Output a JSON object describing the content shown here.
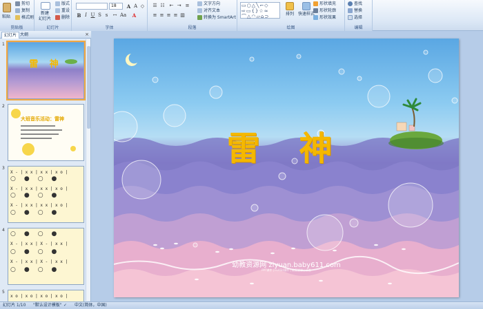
{
  "ribbon": {
    "groups": [
      {
        "name": "clipboard",
        "title": "剪贴板"
      },
      {
        "name": "slides",
        "title": "幻灯片"
      },
      {
        "name": "font",
        "title": "字体"
      },
      {
        "name": "paragraph",
        "title": "段落"
      },
      {
        "name": "drawing",
        "title": "绘图"
      },
      {
        "name": "editing",
        "title": "编辑"
      }
    ],
    "clipboard": {
      "paste": "粘贴",
      "cut": "剪切",
      "copy": "复制",
      "format_painter": "格式刷"
    },
    "slides": {
      "new_slide_line1": "新建",
      "new_slide_line2": "幻灯片",
      "layout": "版式",
      "reset": "重设",
      "delete": "删除"
    },
    "font": {
      "font_name": "",
      "font_size": "18"
    },
    "paragraph": {
      "text_direction": "文字方向",
      "align_text": "对齐文本",
      "smartart": "转换为 SmartArt"
    },
    "drawing": {
      "arrange": "排列",
      "quick_styles": "快速样式",
      "shape_fill": "形状填充",
      "shape_outline": "形状轮廓",
      "shape_effects": "形状效果"
    },
    "editing": {
      "find": "查找",
      "replace": "替换",
      "select": "选择"
    }
  },
  "panel": {
    "tab_slides": "幻灯片",
    "tab_outline": "大纲",
    "close": "×",
    "thumbs": [
      {
        "num": "1",
        "title": "雷 神"
      },
      {
        "num": "2",
        "title": "大班音乐活动：雷神"
      },
      {
        "num": "3",
        "rows": [
          "X - | x x | x x | x o |",
          "X - | x x | x x | x o |",
          "X - | x x | x x | x o |"
        ]
      },
      {
        "num": "4",
        "rows": [
          "X - | x x | X - | x x |",
          "X - | x x | X - | x x |"
        ]
      },
      {
        "num": "5",
        "rows": [
          "x o | x o | x o | x o |"
        ]
      }
    ]
  },
  "slide": {
    "title": "雷  神",
    "watermark": "幼教资源网 ziyuan.baby611.com",
    "watermark_small": "PPT课件 | FLASH课件 | 教案说课 | 试卷"
  },
  "status": {
    "slide_info": "幻灯片 1/10",
    "theme": "\"默认设计模板\"",
    "language": "中文(简体，中国)"
  },
  "colors": {
    "title": "#f4b800",
    "selection": "#f3a940",
    "ribbon": "#dce8f6"
  }
}
